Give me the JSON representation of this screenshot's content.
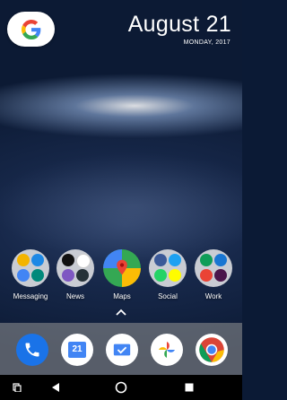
{
  "status": {
    "date": "August 21",
    "weekday_year": "MONDAY, 2017"
  },
  "search_widget": {
    "icon": "google-g-icon"
  },
  "folders": [
    {
      "label": "Messaging"
    },
    {
      "label": "News"
    },
    {
      "label": "Maps"
    },
    {
      "label": "Social"
    },
    {
      "label": "Work"
    }
  ],
  "dock": {
    "apps": [
      "phone-icon",
      "calendar-icon",
      "inbox-icon",
      "photos-icon",
      "chrome-icon"
    ],
    "calendar_day": "21"
  },
  "nav": [
    "recent-apps-icon",
    "back-icon",
    "home-icon",
    "overview-icon"
  ],
  "colors": {
    "google_blue": "#4285F4",
    "google_red": "#EA4335",
    "google_yellow": "#FBBC05",
    "google_green": "#34A853"
  }
}
